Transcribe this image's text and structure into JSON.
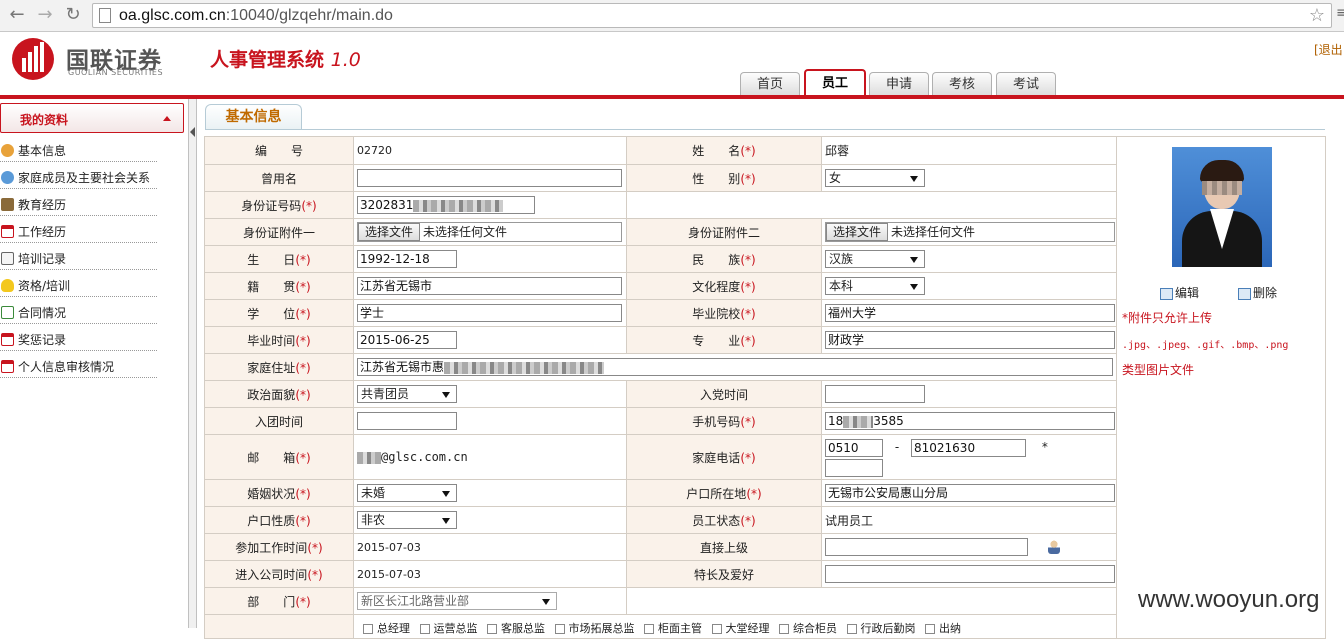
{
  "browser": {
    "url_host": "oa.glsc.com.cn",
    "url_rest": ":10040/glzqehr/main.do"
  },
  "header": {
    "logo_cn": "国联证券",
    "logo_en": "GUOLIAN SECURITIES",
    "system_title": "人事管理系统",
    "system_version": "1.0",
    "logout": "[退出"
  },
  "tabs": [
    {
      "label": "首页",
      "active": false
    },
    {
      "label": "员工",
      "active": true
    },
    {
      "label": "申请",
      "active": false
    },
    {
      "label": "考核",
      "active": false
    },
    {
      "label": "考试",
      "active": false
    }
  ],
  "sidebar": {
    "title": "我的资料",
    "items": [
      {
        "label": "基本信息",
        "icon": "user-icon"
      },
      {
        "label": "家庭成员及主要社会关系",
        "icon": "family-icon"
      },
      {
        "label": "教育经历",
        "icon": "education-icon"
      },
      {
        "label": "工作经历",
        "icon": "calendar-icon"
      },
      {
        "label": "培训记录",
        "icon": "notepad-icon"
      },
      {
        "label": "资格/培训",
        "icon": "bulb-icon"
      },
      {
        "label": "合同情况",
        "icon": "contract-icon"
      },
      {
        "label": "奖惩记录",
        "icon": "award-icon"
      },
      {
        "label": "个人信息审核情况",
        "icon": "review-icon"
      }
    ]
  },
  "content_tab": "基本信息",
  "form": {
    "req_mark": "(*)",
    "emp_no_label": "编　　号",
    "emp_no": "02720",
    "name_label": "姓　　名",
    "name": "邱蓉",
    "former_name_label": "曾用名",
    "former_name": "",
    "gender_label": "性　　别",
    "gender": "女",
    "id_label": "身份证号码",
    "id_value": "3202831",
    "id_attach1_label": "身份证附件一",
    "id_attach2_label": "身份证附件二",
    "file_btn": "选择文件",
    "file_none": "未选择任何文件",
    "birth_label": "生　　日",
    "birth": "1992-12-18",
    "nation_label": "民　　族",
    "nation": "汉族",
    "native_label": "籍　　贯",
    "native": "江苏省无锡市",
    "edu_label": "文化程度",
    "edu": "本科",
    "degree_label": "学　　位",
    "degree": "学士",
    "school_label": "毕业院校",
    "school": "福州大学",
    "grad_label": "毕业时间",
    "grad": "2015-06-25",
    "major_label": "专　　业",
    "major": "财政学",
    "address_label": "家庭住址",
    "address": "江苏省无锡市惠",
    "political_label": "政治面貌",
    "political": "共青团员",
    "party_label": "入党时间",
    "party": "",
    "league_label": "入团时间",
    "league": "",
    "mobile_label": "手机号码",
    "mobile_a": "18",
    "mobile_b": "3585",
    "email_label": "邮　　箱",
    "email": "@glsc.com.cn",
    "home_phone_label": "家庭电话",
    "home_area": "0510",
    "home_dash": "-",
    "home_number": "81021630",
    "home_star": "*",
    "home_ext": "",
    "marital_label": "婚姻状况",
    "marital": "未婚",
    "hukou_loc_label": "户口所在地",
    "hukou_loc": "无锡市公安局惠山分局",
    "hukou_type_label": "户口性质",
    "hukou_type": "非农",
    "status_label": "员工状态",
    "status": "试用员工",
    "work_start_label": "参加工作时间",
    "work_start": "2015-07-03",
    "supervisor_label": "直接上级",
    "supervisor": "",
    "join_label": "进入公司时间",
    "join": "2015-07-03",
    "hobby_label": "特长及爱好",
    "hobby": "",
    "dept_label": "部　　门",
    "dept": "新区长江北路营业部",
    "positions": [
      "总经理",
      "运营总监",
      "客服总监",
      "市场拓展总监",
      "柜面主管",
      "大堂经理",
      "综合柜员",
      "行政后勤岗",
      "出纳"
    ]
  },
  "photo_panel": {
    "edit": "编辑",
    "delete": "删除",
    "note1": "*附件只允许上传",
    "note2": ".jpg、.jpeg、.gif、.bmp、.png",
    "note3": "类型图片文件"
  },
  "watermark": "www.wooyun.org"
}
